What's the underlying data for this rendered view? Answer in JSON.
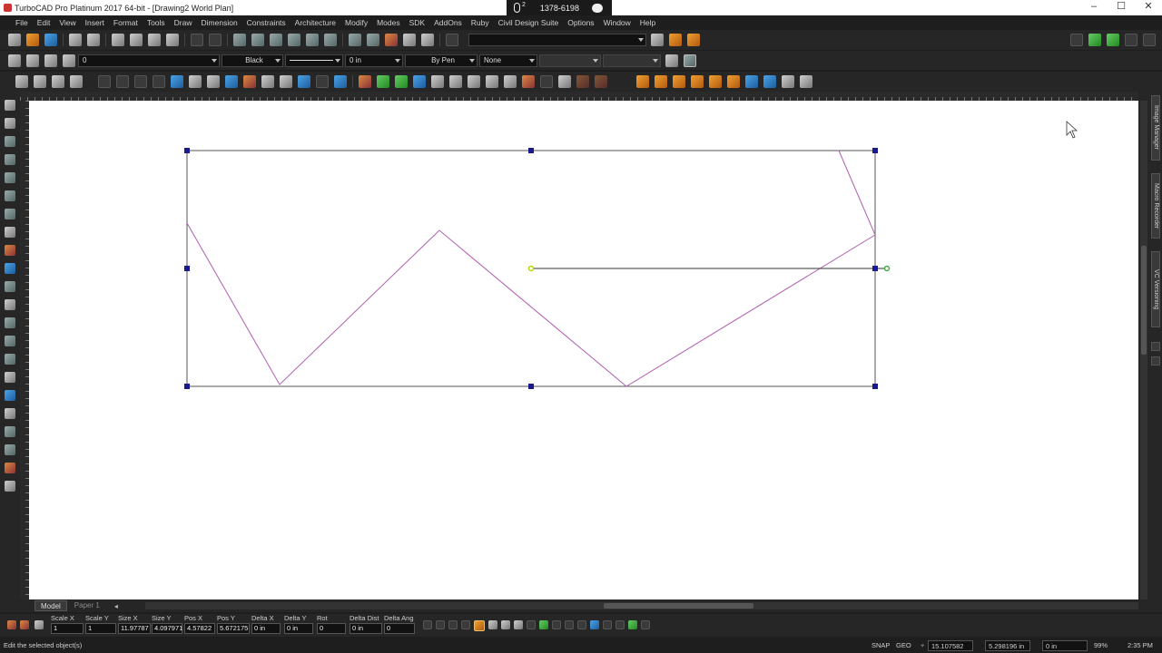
{
  "window": {
    "title": "TurboCAD Pro Platinum 2017 64-bit - [Drawing2 World Plan]",
    "controls": [
      "minimize",
      "maximize",
      "close"
    ]
  },
  "recording_overlay": {
    "mic_badge": "2",
    "number": "1378-6198"
  },
  "menu": [
    "File",
    "Edit",
    "View",
    "Insert",
    "Format",
    "Tools",
    "Draw",
    "Dimension",
    "Constraints",
    "Architecture",
    "Modify",
    "Modes",
    "SDK",
    "AddOns",
    "Ruby",
    "Civil Design Suite",
    "Options",
    "Window",
    "Help"
  ],
  "property_bar": {
    "layer_value": "0",
    "color_value": "Black",
    "thickness_value": "0 in",
    "pen_value": "By Pen",
    "fill_value": "None"
  },
  "right_tabs": [
    "Image Manager",
    "Macro Recorder",
    "VC Versioning"
  ],
  "model_tabs": [
    {
      "label": "Model",
      "active": true
    },
    {
      "label": "Paper 1",
      "active": false
    }
  ],
  "inspector": {
    "fields": [
      {
        "label": "Scale X",
        "value": "1"
      },
      {
        "label": "Scale Y",
        "value": "1"
      },
      {
        "label": "Size X",
        "value": "11.97787"
      },
      {
        "label": "Size Y",
        "value": "4.097971"
      },
      {
        "label": "Pos X",
        "value": "4.57822"
      },
      {
        "label": "Pos Y",
        "value": "5.672175"
      },
      {
        "label": "Delta X",
        "value": "0 in"
      },
      {
        "label": "Delta Y",
        "value": "0 in"
      },
      {
        "label": "Rot",
        "value": "0"
      },
      {
        "label": "Delta Dist",
        "value": "0 in"
      },
      {
        "label": "Delta Ang",
        "value": "0"
      }
    ]
  },
  "status": {
    "message": "Edit the selected object(s)",
    "snap": "SNAP",
    "geo": "GEO",
    "coord_x": "15.107582 in",
    "coord_y": "5.298196 in",
    "coord_z": "0 in",
    "zoom": "99%",
    "time": "2:35 PM"
  },
  "colors": {
    "polyline": "#b05fb0",
    "bounding_box": "#444444",
    "handle": "#1a1a8c",
    "pivot_handle": "#b8d400",
    "rotate_handle": "#44aa44"
  }
}
